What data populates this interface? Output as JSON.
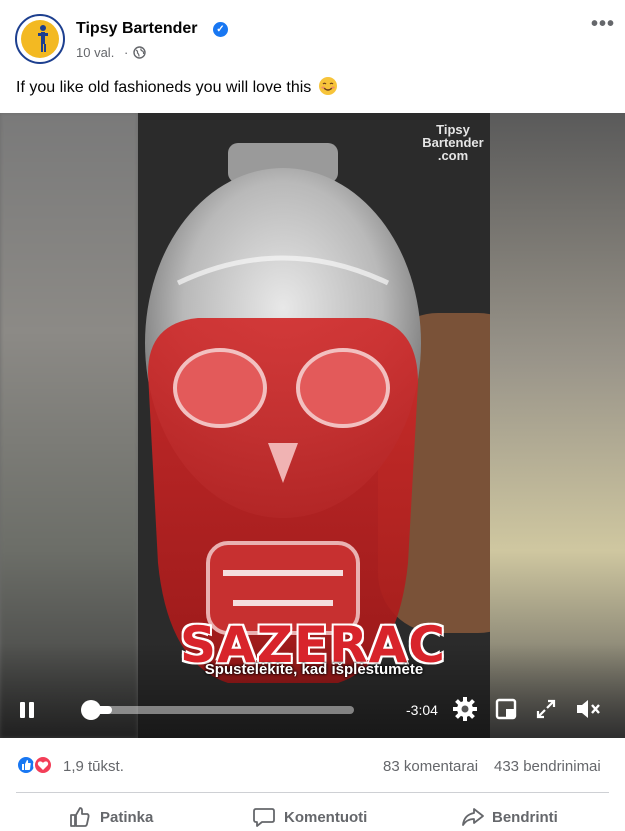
{
  "post": {
    "page_name": "Tipsy Bartender",
    "verified_icon": "verified-badge-icon",
    "time": "10 val.",
    "separator": "·",
    "audience_icon": "globe-icon",
    "caption": "If you like old fashioneds you will love this",
    "caption_emoji": "smiling-face-emoji"
  },
  "video": {
    "watermark_line1": "Tipsy",
    "watermark_line2": "Bartender",
    "watermark_line3": ".com",
    "title_overlay": "SAZERAC",
    "subtitle": "Spustelėkite, kad išplėstumėte",
    "time_remaining": "-3:04",
    "progress_fraction": 0.11
  },
  "reactions": {
    "count": "1,9 tūkst.",
    "comments": "83 komentarai",
    "shares": "433 bendrinimai"
  },
  "actions": {
    "like": "Patinka",
    "comment": "Komentuoti",
    "share": "Bendrinti"
  },
  "colors": {
    "accent": "#1877f2",
    "love": "#f33e58",
    "title_red": "#d8242b",
    "secondary_text": "#65676b"
  }
}
